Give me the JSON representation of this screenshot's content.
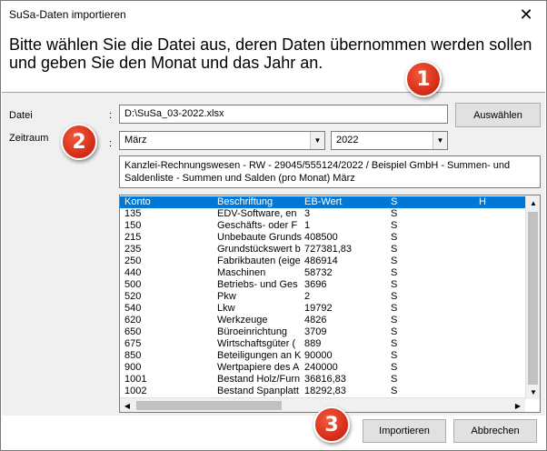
{
  "window": {
    "title": "SuSa-Daten importieren",
    "close_icon": "✕"
  },
  "intro_text": "Bitte wählen Sie die Datei aus, deren Daten übernommen werden sollen und geben Sie den Monat und das Jahr an.",
  "file": {
    "label": "Datei",
    "colon": ":",
    "value": "D:\\SuSa_03-2022.xlsx",
    "browse_label": "Auswählen"
  },
  "period": {
    "label": "Zeitraum",
    "colon": ":",
    "month": "März",
    "year": "2022"
  },
  "info_text": "Kanzlei-Rechnungswesen - RW - 29045/555124/2022 / Beispiel GmbH - Summen- und Saldenliste - Summen und Salden (pro Monat) März",
  "table": {
    "headers": [
      "Konto",
      "Beschriftung",
      "EB-Wert",
      "S",
      "H"
    ],
    "rows": [
      [
        "135",
        "EDV-Software, en",
        "3",
        "S"
      ],
      [
        "150",
        "Geschäfts- oder F",
        "1",
        "S"
      ],
      [
        "215",
        "Unbebaute Grunds",
        "408500",
        "S"
      ],
      [
        "235",
        "Grundstückswert b",
        "727381,83",
        "S"
      ],
      [
        "250",
        "Fabrikbauten (eige",
        "486914",
        "S"
      ],
      [
        "440",
        "Maschinen",
        "58732",
        "S"
      ],
      [
        "500",
        "Betriebs- und Ges",
        "3696",
        "S"
      ],
      [
        "520",
        "Pkw",
        "2",
        "S"
      ],
      [
        "540",
        "Lkw",
        "19792",
        "S"
      ],
      [
        "620",
        "Werkzeuge",
        "4826",
        "S"
      ],
      [
        "650",
        "Büroeinrichtung",
        "3709",
        "S"
      ],
      [
        "675",
        "Wirtschaftsgüter (",
        "889",
        "S"
      ],
      [
        "850",
        "Beteiligungen an K",
        "90000",
        "S"
      ],
      [
        "900",
        "Wertpapiere des A",
        "240000",
        "S"
      ],
      [
        "1001",
        "Bestand Holz/Furn",
        "36816,83",
        "S"
      ],
      [
        "1002",
        "Bestand Spanplatt",
        "18292,83",
        "S"
      ]
    ]
  },
  "buttons": {
    "import_label": "Importieren",
    "cancel_label": "Abbrechen"
  },
  "badges": [
    "1",
    "2",
    "3"
  ],
  "icons": {
    "dropdown": "▼",
    "up": "▲",
    "down": "▼",
    "left": "◀",
    "right": "▶"
  },
  "colors": {
    "selection": "#0078d7",
    "badge": "#d8301b",
    "dialog_bg": "#f0f0f0"
  }
}
